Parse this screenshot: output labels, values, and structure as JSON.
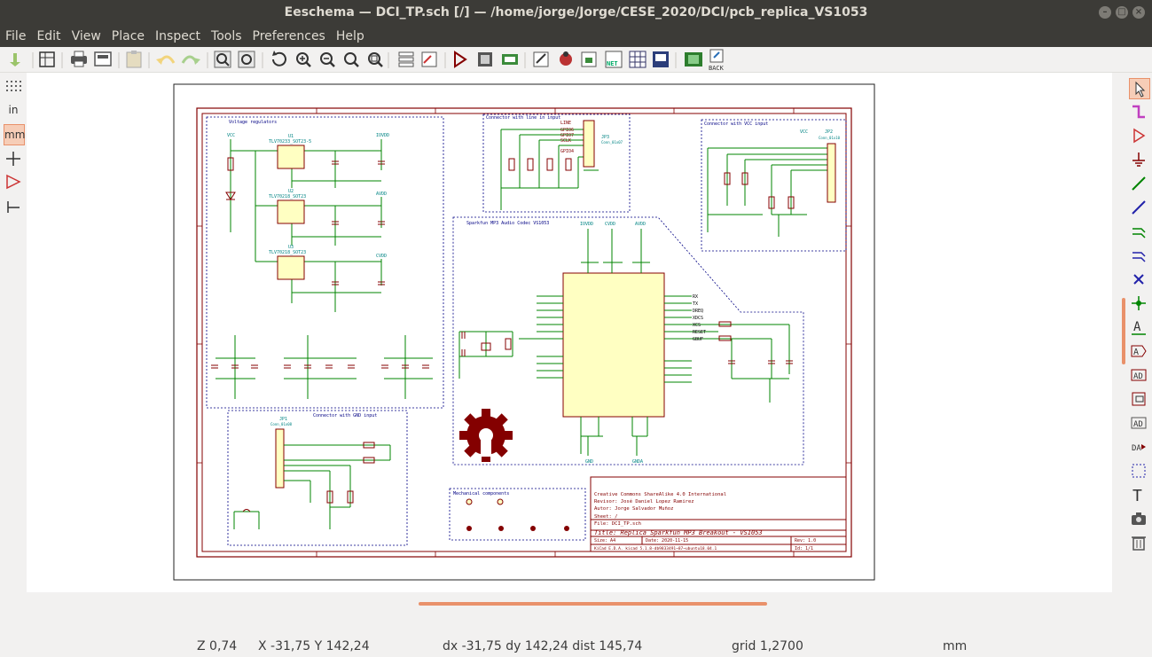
{
  "window": {
    "title": "Eeschema — DCI_TP.sch [/] — /home/jorge/Jorge/CESE_2020/DCI/pcb_replica_VS1053"
  },
  "menu": [
    "File",
    "Edit",
    "View",
    "Place",
    "Inspect",
    "Tools",
    "Preferences",
    "Help"
  ],
  "toolbar": {
    "back_label": "BACK",
    "net_label": "NET"
  },
  "left_toolbar": {
    "units_in": "in",
    "units_mm": "mm"
  },
  "colors": {
    "wire": "#008400",
    "component": "#840000",
    "label": "#008484",
    "border": "#840000",
    "accent": "#e9916a"
  },
  "schematic": {
    "sections": {
      "voltage_regulators": "Voltage regulators",
      "connector_line_in": "Connector with line in input",
      "connector_vcc": "Connector with VCC input",
      "sparkfun_core": "Sparkfun MP3 Audio Codec VS1053",
      "connector_gnd": "Connector with GND input",
      "mechanical": "Mechanical components"
    },
    "regulators": [
      {
        "ref": "U1",
        "value": "TLV70233_SOT23-5"
      },
      {
        "ref": "U2",
        "value": "TLV70218_SOT23"
      },
      {
        "ref": "U3",
        "value": "TLV70218_SOT23"
      }
    ],
    "power_nets": [
      "VCC",
      "IOVDD",
      "AVDD",
      "CVDD",
      "GND",
      "GNDA"
    ],
    "connectors": [
      {
        "ref": "JP1",
        "value": "Conn_01x08"
      },
      {
        "ref": "JP2",
        "value": "Conn_01x10"
      },
      {
        "ref": "JP3",
        "value": "Conn_01x07"
      }
    ],
    "right_pin_labels": [
      "RX",
      "TX",
      "DREQ",
      "XDCS",
      "XCS",
      "RESET",
      "GBUF"
    ],
    "line_in_labels": [
      "LINE",
      "GPIO6",
      "GPIO7",
      "SCLK",
      "GPIO4"
    ]
  },
  "title_block": {
    "license": "Creative Commons ShareAlike 4.0 International",
    "reviewer": "Revisor: José Daniel Lopez Ramirez",
    "author": "Autor: Jorge Salvador Muñoz",
    "sheet": "Sheet: /",
    "file": "File: DCI_TP.sch",
    "title": "Title: Replica Sparkfun MP3 Breakout - VS1053",
    "size": "Size: A4",
    "date": "Date: 2020-11-15",
    "rev": "Rev: 1.0",
    "kicad": "KiCad E.D.A.  kicad 5.1.8-db9833491~87~ubuntu18.04.1",
    "id": "Id: 1/1"
  },
  "status": {
    "zoom": "Z 0,74",
    "xy": "X -31,75  Y 142,24",
    "delta": "dx -31,75  dy 142,24  dist 145,74",
    "grid": "grid 1,2700",
    "units": "mm"
  }
}
